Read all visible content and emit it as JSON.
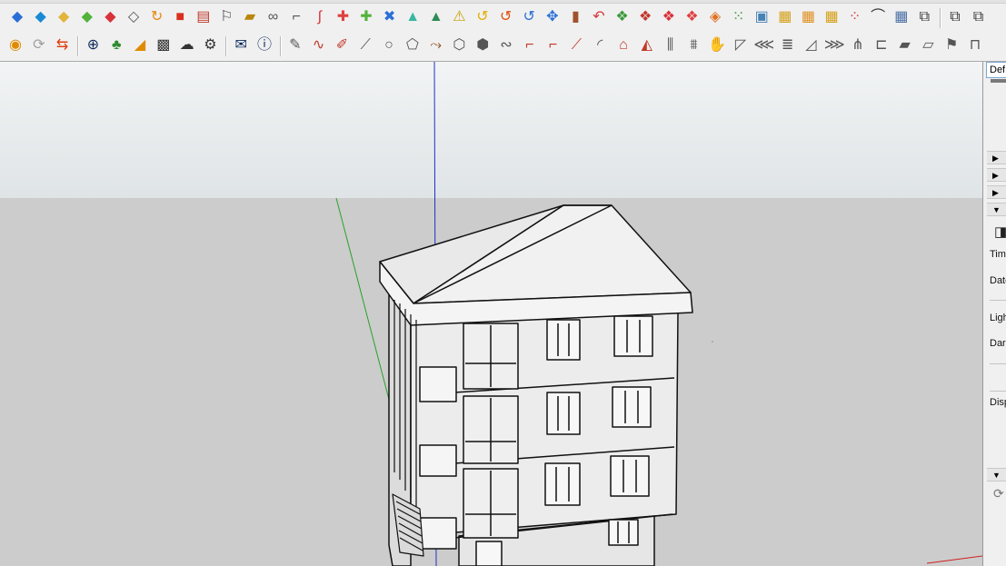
{
  "toolbar_row_1": [
    {
      "name": "front-face-icon",
      "glyph": "◆",
      "color": "#2b6fd6"
    },
    {
      "name": "top-face-icon",
      "glyph": "◆",
      "color": "#1a8ad4"
    },
    {
      "name": "flat-face-icon",
      "glyph": "◆",
      "color": "#e2b43a"
    },
    {
      "name": "green-face-icon",
      "glyph": "◆",
      "color": "#52b33a"
    },
    {
      "name": "red-face-icon",
      "glyph": "◆",
      "color": "#d8323a"
    },
    {
      "name": "outline-face-icon",
      "glyph": "◇",
      "color": "#555555"
    },
    {
      "name": "rotate-orange-icon",
      "glyph": "↻",
      "color": "#e88a12"
    },
    {
      "name": "square-red-icon",
      "glyph": "■",
      "color": "#d83020"
    },
    {
      "name": "grid-box-icon",
      "glyph": "▤",
      "color": "#c0392b"
    },
    {
      "name": "flag-icon",
      "glyph": "⚐",
      "color": "#444444"
    },
    {
      "name": "box-icon",
      "glyph": "▰",
      "color": "#b8860b"
    },
    {
      "name": "link-icon",
      "glyph": "∞",
      "color": "#555555"
    },
    {
      "name": "corner-icon",
      "glyph": "⌐",
      "color": "#555555"
    },
    {
      "name": "curve-red-icon",
      "glyph": "∫",
      "color": "#d8323a"
    },
    {
      "name": "plus-red-icon",
      "glyph": "✚",
      "color": "#e04040"
    },
    {
      "name": "plus-green-icon",
      "glyph": "✚",
      "color": "#52b33a"
    },
    {
      "name": "cross-blue-icon",
      "glyph": "✖",
      "color": "#2b6fd6"
    },
    {
      "name": "cone-icon",
      "glyph": "▲",
      "color": "#3ab5a0"
    },
    {
      "name": "cone-dark-icon",
      "glyph": "▲",
      "color": "#2e8b57"
    },
    {
      "name": "warning-triangle-icon",
      "glyph": "⚠",
      "color": "#c9a000"
    },
    {
      "name": "arc-yellow-icon",
      "glyph": "↺",
      "color": "#e0b000"
    },
    {
      "name": "arc-orange-icon",
      "glyph": "↺",
      "color": "#e05010"
    },
    {
      "name": "arc-blue-icon",
      "glyph": "↺",
      "color": "#2b6fd6"
    },
    {
      "name": "move-arrows-icon",
      "glyph": "✥",
      "color": "#2b6fd6"
    },
    {
      "name": "cylinder-icon",
      "glyph": "▮",
      "color": "#a0522d"
    },
    {
      "name": "undo-red-icon",
      "glyph": "↶",
      "color": "#d8323a"
    },
    {
      "name": "cube-green-icon",
      "glyph": "❖",
      "color": "#3a9a3a"
    },
    {
      "name": "cube-multi-icon",
      "glyph": "❖",
      "color": "#c0392b"
    },
    {
      "name": "cube-stack-icon",
      "glyph": "❖",
      "color": "#d8323a"
    },
    {
      "name": "cube-red-icon",
      "glyph": "❖",
      "color": "#e04040"
    },
    {
      "name": "tag-icon",
      "glyph": "◈",
      "color": "#e07020"
    },
    {
      "name": "grid-dots-icon",
      "glyph": "⁙",
      "color": "#3a9a3a"
    },
    {
      "name": "frame-icon",
      "glyph": "▣",
      "color": "#4682b4"
    },
    {
      "name": "hatch-box-icon",
      "glyph": "▦",
      "color": "#d4a017"
    },
    {
      "name": "grid-orange-icon",
      "glyph": "▦",
      "color": "#e09020"
    },
    {
      "name": "grid-yellow-icon",
      "glyph": "▦",
      "color": "#d4a017"
    },
    {
      "name": "scatter-icon",
      "glyph": "⁘",
      "color": "#d8323a"
    },
    {
      "name": "curve-dots-icon",
      "glyph": "⌒",
      "color": "#333333"
    },
    {
      "name": "panel-grid-icon",
      "glyph": "▦",
      "color": "#4a6fa5"
    },
    {
      "name": "components-icon",
      "glyph": "⧉",
      "color": "#333333"
    },
    {
      "name": "layers-icon",
      "glyph": "⧉",
      "color": "#333333"
    },
    {
      "name": "scenes-icon",
      "glyph": "⧉",
      "color": "#333333"
    }
  ],
  "toolbar_row_2": [
    {
      "name": "extension-warehouse-icon",
      "glyph": "◉",
      "color": "#e08a00"
    },
    {
      "name": "refresh-icon",
      "glyph": "⟳",
      "color": "#a0a0a0"
    },
    {
      "name": "transfer-icon",
      "glyph": "⇆",
      "color": "#e04010"
    },
    {
      "name": "add-location-icon",
      "glyph": "⊕",
      "color": "#0a2a5a"
    },
    {
      "name": "tree-icon",
      "glyph": "♣",
      "color": "#2e8b2e"
    },
    {
      "name": "terrain-icon",
      "glyph": "◢",
      "color": "#e08a00"
    },
    {
      "name": "checker-icon",
      "glyph": "▩",
      "color": "#333333"
    },
    {
      "name": "cloud-upload-icon",
      "glyph": "☁",
      "color": "#333333"
    },
    {
      "name": "gear-icon",
      "glyph": "⚙",
      "color": "#333333"
    },
    {
      "name": "mail-icon",
      "glyph": "✉",
      "color": "#0a2a5a"
    },
    {
      "name": "info-icon",
      "glyph": "ⓘ",
      "color": "#0a2a5a"
    },
    {
      "name": "pencil-tool-icon",
      "glyph": "✎",
      "color": "#555555"
    },
    {
      "name": "curve-tool-icon",
      "glyph": "∿",
      "color": "#c0392b"
    },
    {
      "name": "paint-tool-icon",
      "glyph": "✐",
      "color": "#c0392b"
    },
    {
      "name": "knife-tool-icon",
      "glyph": "⟋",
      "color": "#555555"
    },
    {
      "name": "circle-tool-icon",
      "glyph": "○",
      "color": "#555555"
    },
    {
      "name": "shape-tool-icon",
      "glyph": "⬠",
      "color": "#555555"
    },
    {
      "name": "bend-tool-icon",
      "glyph": "⤳",
      "color": "#8b4513"
    },
    {
      "name": "cube-tool-icon",
      "glyph": "⬡",
      "color": "#555555"
    },
    {
      "name": "box-tool-icon",
      "glyph": "⬢",
      "color": "#555555"
    },
    {
      "name": "spring-tool-icon",
      "glyph": "∾",
      "color": "#555555"
    },
    {
      "name": "fillet-tool-icon",
      "glyph": "⌐",
      "color": "#c0392b"
    },
    {
      "name": "chamfer-tool-icon",
      "glyph": "⌐",
      "color": "#c0392b"
    },
    {
      "name": "line-tool-icon",
      "glyph": "⟋",
      "color": "#c0392b"
    },
    {
      "name": "arc-tool-icon",
      "glyph": "◜",
      "color": "#555555"
    },
    {
      "name": "roof-tool-icon",
      "glyph": "⌂",
      "color": "#c0392b"
    },
    {
      "name": "wedge-tool-icon",
      "glyph": "◭",
      "color": "#c0392b"
    },
    {
      "name": "columns-tool-icon",
      "glyph": "⫼",
      "color": "#555555"
    },
    {
      "name": "fence-tool-icon",
      "glyph": "⩩",
      "color": "#555555"
    },
    {
      "name": "hand-tool-icon",
      "glyph": "✋",
      "color": "#555555"
    },
    {
      "name": "sheet-tool-icon",
      "glyph": "◸",
      "color": "#555555"
    },
    {
      "name": "fold-tool-icon",
      "glyph": "⋘",
      "color": "#555555"
    },
    {
      "name": "stack-tool-icon",
      "glyph": "≣",
      "color": "#555555"
    },
    {
      "name": "ramp-tool-icon",
      "glyph": "◿",
      "color": "#555555"
    },
    {
      "name": "arrows-tool-icon",
      "glyph": "⋙",
      "color": "#555555"
    },
    {
      "name": "split-tool-icon",
      "glyph": "⋔",
      "color": "#555555"
    },
    {
      "name": "bracket-tool-icon",
      "glyph": "⊏",
      "color": "#555555"
    },
    {
      "name": "block-tool-icon",
      "glyph": "▰",
      "color": "#555555"
    },
    {
      "name": "slanted-tool-icon",
      "glyph": "▱",
      "color": "#555555"
    },
    {
      "name": "flag-tool-icon",
      "glyph": "⚑",
      "color": "#555555"
    },
    {
      "name": "gate-tool-icon",
      "glyph": "⊓",
      "color": "#555555"
    }
  ],
  "tray": {
    "header": "Def",
    "time_label": "Time",
    "date_label": "Date",
    "light_label": "Ligh",
    "dark_label": "Dark",
    "display_label": "Disp"
  },
  "viewport_colors": {
    "sky_top": "#f2f4f5",
    "ground": "#cccccc",
    "axis_blue": "#2030c8",
    "axis_green": "#2aa02a",
    "axis_red": "#d02020"
  }
}
